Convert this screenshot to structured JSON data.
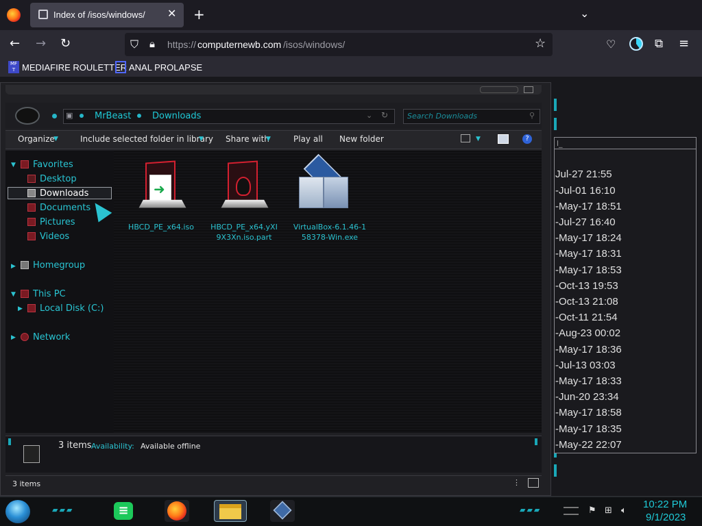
{
  "browser": {
    "tab_title": "Index of /isos/windows/",
    "url_prefix": "https://",
    "url_domain": "computernewb.com",
    "url_path": "/isos/windows/",
    "bookmarks": [
      {
        "label": "MEDIAFIRE ROULETTER",
        "icon_text": "MF T"
      },
      {
        "label": "ANAL PROLAPSE"
      }
    ],
    "icons": [
      "firefox-icon",
      "close-icon",
      "plus-icon",
      "chevron-down-icon",
      "back-icon",
      "forward-icon",
      "reload-icon",
      "shield-icon",
      "lock-icon",
      "star-icon",
      "pocket-icon",
      "account-icon",
      "extensions-icon",
      "menu-icon"
    ]
  },
  "explorer": {
    "breadcrumb": [
      "MrBeast",
      "Downloads"
    ],
    "search_placeholder": "Search Downloads",
    "toolbar": {
      "organize": "Organize",
      "include": "Include selected folder in library",
      "share": "Share with",
      "play_all": "Play all",
      "new_folder": "New folder",
      "help": "?"
    },
    "nav": {
      "favorites": "Favorites",
      "desktop": "Desktop",
      "downloads": "Downloads",
      "documents": "Documents",
      "pictures": "Pictures",
      "videos": "Videos",
      "homegroup": "Homegroup",
      "this_pc": "This PC",
      "local_disk": "Local Disk (C:)",
      "network": "Network"
    },
    "files": [
      {
        "name_line1": "HBCD_PE_x64.iso",
        "name_line2": ""
      },
      {
        "name_line1": "HBCD_PE_x64.yXI",
        "name_line2": "9X3Xn.iso.part"
      },
      {
        "name_line1": "VirtualBox-6.1.46-1",
        "name_line2": "58378-Win.exe"
      }
    ],
    "details": {
      "count": "3 items",
      "availability_label": "Availability:",
      "availability_value": "Available offline"
    },
    "status": "3 items",
    "accent_color": "#2bc3d1"
  },
  "listing": {
    "header": "l_",
    "dates": [
      "Jul-27 21:55",
      "-Jul-01 16:10",
      "-May-17 18:51",
      "-Jul-27 16:40",
      "-May-17 18:24",
      "-May-17 18:31",
      "-May-17 18:53",
      "-Oct-13 19:53",
      "-Oct-13 21:08",
      "-Oct-11 21:54",
      "-Aug-23 00:02",
      "-May-17 18:36",
      "-Jul-13 03:03",
      "-May-17 18:33",
      "-Jun-20 23:34",
      "-May-17 18:58",
      "-May-17 18:35",
      "-May-22 22:07"
    ]
  },
  "taskbar": {
    "time": "10:22 PM",
    "date": "9/1/2023",
    "green_app_glyph": "≡"
  }
}
